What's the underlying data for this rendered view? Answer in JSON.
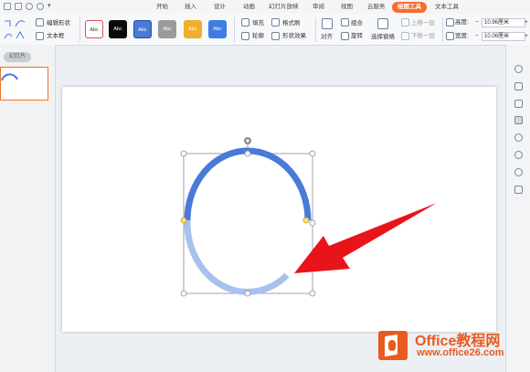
{
  "menu_tabs": [
    "开始",
    "插入",
    "设计",
    "动画",
    "幻灯片放映",
    "审阅",
    "视图",
    "云服务",
    "绘图工具",
    "文本工具"
  ],
  "active_tab": "绘图工具",
  "ribbon": {
    "edit_shape": "编辑形状",
    "text_box": "文本框",
    "shape_style_sample": "Abc",
    "fill": "填充",
    "format_painter": "格式刷",
    "outline": "轮廓",
    "shape_effects": "形状效果",
    "align": "对齐",
    "group": "组合",
    "rotate": "旋转",
    "selection_pane": "选择窗格",
    "bring_forward": "上移一层",
    "send_backward": "下移一层",
    "height_label": "高度:",
    "height_value": "10.96厘米",
    "width_label": "宽度:",
    "width_value": "10.06厘米",
    "minus": "−",
    "plus": "+"
  },
  "left_panel": {
    "tab_label": "幻灯片"
  },
  "shape": {
    "top_arc_color": "#4a7ad8",
    "bottom_arc_color": "#a9c1ee",
    "arrow_color": "#e8141a"
  },
  "watermark": {
    "title": "Office教程网",
    "url": "www.office26.com"
  }
}
